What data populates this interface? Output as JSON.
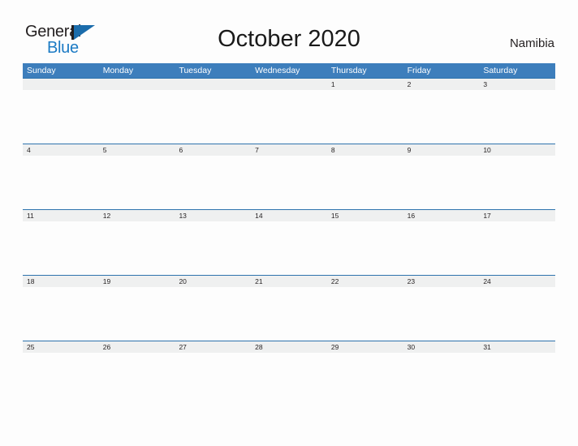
{
  "page": {
    "background_color": "#fdfdfd"
  },
  "logo": {
    "name": "General Blue",
    "word_top": "General",
    "word_bottom": "Blue",
    "text_color": "#231f20",
    "accent_color": "#1b7ac4"
  },
  "header": {
    "title": "October 2020",
    "country": "Namibia"
  },
  "calendar": {
    "month": "October",
    "year": "2020",
    "header_background": "#3d7ebc",
    "date_strip_background": "#eff0f0",
    "rule_color": "#2e73ad",
    "weekdays": [
      {
        "label": "Sunday"
      },
      {
        "label": "Monday"
      },
      {
        "label": "Tuesday"
      },
      {
        "label": "Wednesday"
      },
      {
        "label": "Thursday"
      },
      {
        "label": "Friday"
      },
      {
        "label": "Saturday"
      }
    ],
    "weeks": [
      {
        "days": [
          "",
          "",
          "",
          "",
          "1",
          "2",
          "3"
        ]
      },
      {
        "days": [
          "4",
          "5",
          "6",
          "7",
          "8",
          "9",
          "10"
        ]
      },
      {
        "days": [
          "11",
          "12",
          "13",
          "14",
          "15",
          "16",
          "17"
        ]
      },
      {
        "days": [
          "18",
          "19",
          "20",
          "21",
          "22",
          "23",
          "24"
        ]
      },
      {
        "days": [
          "25",
          "26",
          "27",
          "28",
          "29",
          "30",
          "31"
        ]
      }
    ]
  }
}
